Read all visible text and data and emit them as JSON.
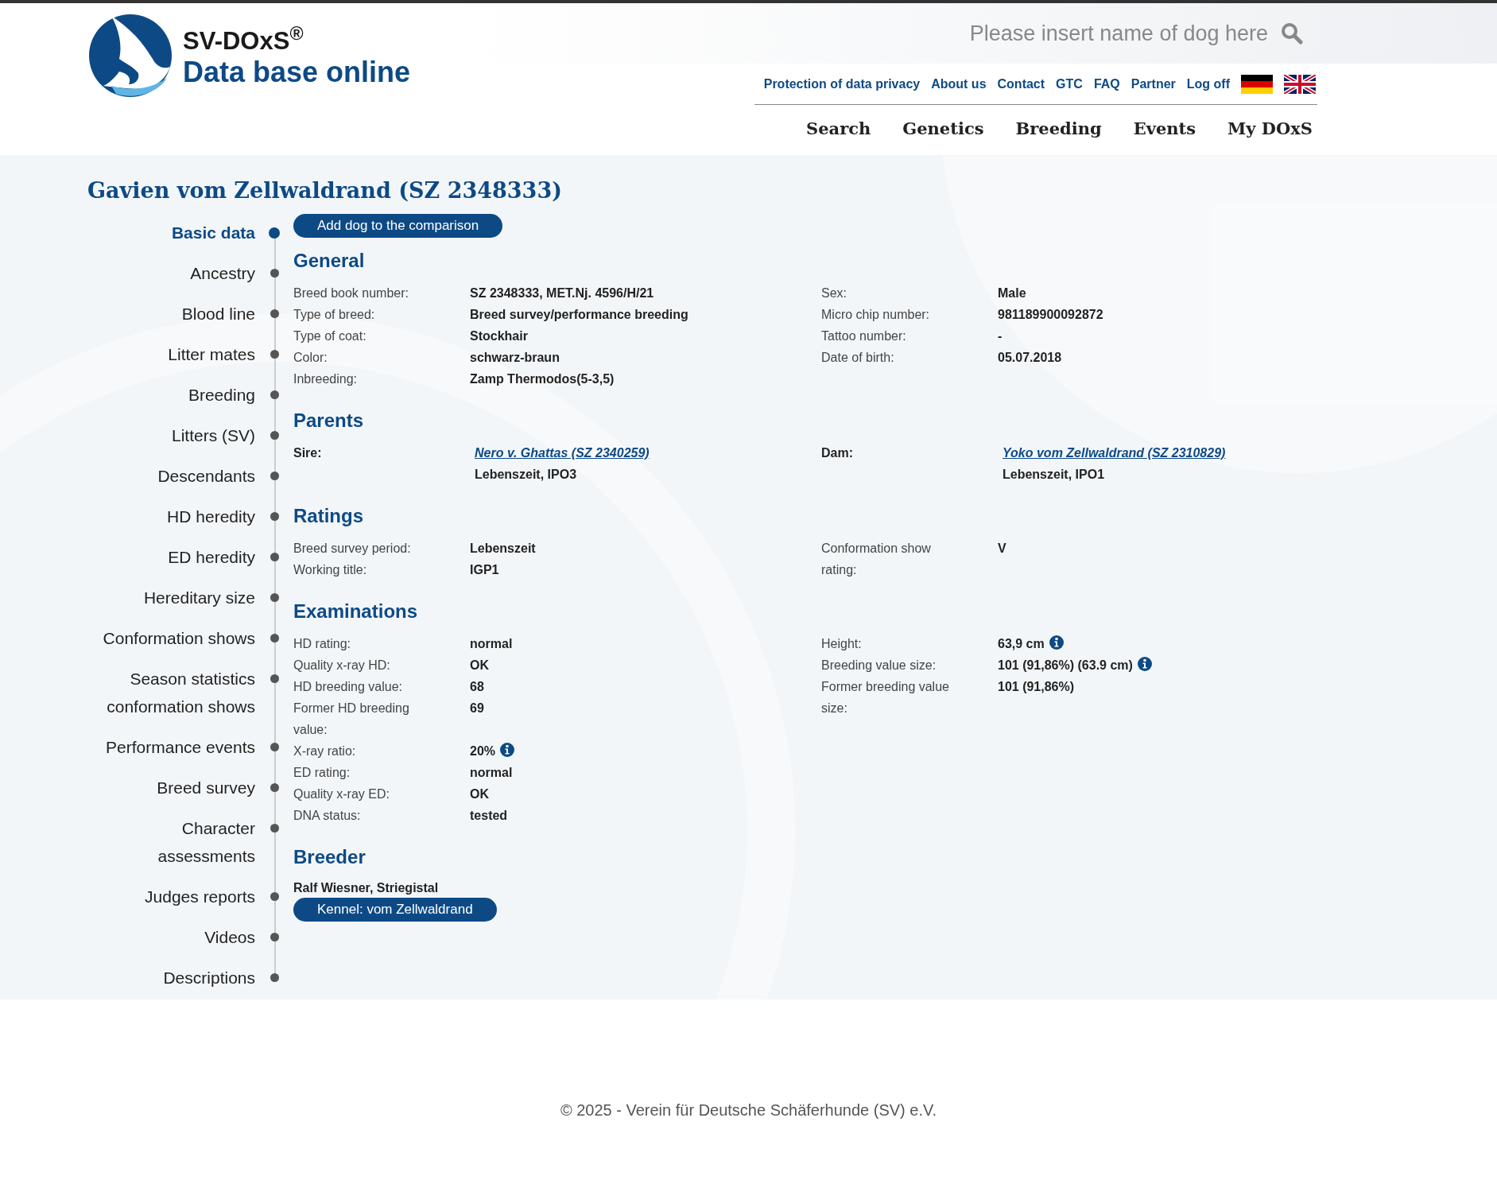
{
  "header": {
    "logo": {
      "name": "SV-DOxS$^{®}$",
      "tagline": "Data base online"
    },
    "search": {
      "placeholder": "Please insert name of dog here"
    },
    "top_links": [
      "Protection of data privacy",
      "About us",
      "Contact",
      "GTC",
      "FAQ",
      "Partner",
      "Log off"
    ],
    "languages": [
      {
        "kind": "german"
      },
      {
        "kind": "british"
      }
    ],
    "main_nav": [
      "Search",
      "Genetics",
      "Breeding",
      "Events",
      "My DOxS"
    ]
  },
  "title": "Gavien vom Zellwaldrand (SZ 2348333)",
  "side_nav": [
    {
      "label": "Basic data",
      "selected": true
    },
    {
      "label": "Ancestry",
      "selected": false
    },
    {
      "label": "Blood line",
      "selected": false
    },
    {
      "label": "Litter mates",
      "selected": false
    },
    {
      "label": "Breeding",
      "selected": false
    },
    {
      "label": "Litters (SV)",
      "selected": false
    },
    {
      "label": "Descendants",
      "selected": false
    },
    {
      "label": "HD heredity",
      "selected": false
    },
    {
      "label": "ED heredity",
      "selected": false
    },
    {
      "label": "Hereditary size",
      "selected": false
    },
    {
      "label": "Conformation shows",
      "selected": false
    },
    {
      "label": "Season statistics conformation shows",
      "selected": false
    },
    {
      "label": "Performance events",
      "selected": false
    },
    {
      "label": "Breed survey",
      "selected": false
    },
    {
      "label": "Character assessments",
      "selected": false
    },
    {
      "label": "Judges reports",
      "selected": false
    },
    {
      "label": "Videos",
      "selected": false
    },
    {
      "label": "Descriptions",
      "selected": false
    }
  ],
  "compare_button": "Add dog to the comparison",
  "sections": [
    {
      "heading": "General",
      "kind": "fields",
      "left": [
        {
          "label": "Breed book number:",
          "value": "SZ 2348333, MET.Nj. 4596/H/21"
        },
        {
          "label": "Type of breed:",
          "value": "Breed survey/performance breeding"
        },
        {
          "label": "Type of coat:",
          "value": "Stockhair"
        },
        {
          "label": "Color:",
          "value": "schwarz-braun"
        },
        {
          "label": "Inbreeding:",
          "value": "Zamp Thermodos(5-3,5)"
        }
      ],
      "right": [
        {
          "label": "Sex:",
          "value": "Male"
        },
        {
          "label": "Micro chip number:",
          "value": "981189900092872"
        },
        {
          "label": "Tattoo number:",
          "value": "-"
        },
        {
          "label": "Date of birth:",
          "value": "05.07.2018"
        }
      ]
    },
    {
      "heading": "Parents",
      "kind": "parents",
      "left": [
        {
          "label": "Sire:",
          "link": "Nero v. Ghattas (SZ 2340259)",
          "note": "Lebenszeit, IPO3"
        }
      ],
      "right": [
        {
          "label": "Dam:",
          "link": "Yoko vom Zellwaldrand (SZ 2310829)",
          "note": "Lebenszeit, IPO1"
        }
      ]
    },
    {
      "heading": "Ratings",
      "kind": "fields",
      "left": [
        {
          "label": "Breed survey period:",
          "value": "Lebenszeit"
        },
        {
          "label": "Working title:",
          "value": "IGP1"
        }
      ],
      "right": [
        {
          "label": "Conformation show rating:",
          "value": "V"
        }
      ]
    },
    {
      "heading": "Examinations",
      "kind": "fields",
      "left": [
        {
          "label": "HD rating:",
          "value": "normal"
        },
        {
          "label": "Quality x-ray HD:",
          "value": "OK"
        },
        {
          "label": "HD breeding value:",
          "value": "68"
        },
        {
          "label": "Former HD breeding value:",
          "value": "69"
        },
        {
          "label": "X-ray ratio:",
          "value": "20%",
          "info": true
        },
        {
          "label": "ED rating:",
          "value": "normal"
        },
        {
          "label": "Quality x-ray ED:",
          "value": "OK"
        },
        {
          "label": "DNA status:",
          "value": "tested"
        }
      ],
      "right": [
        {
          "label": "Height:",
          "value": "63,9 cm",
          "info": true
        },
        {
          "label": "Breeding value size:",
          "value": "101 (91,86%) (63.9 cm)",
          "info": true
        },
        {
          "label": "Former breeding value size:",
          "value": "101 (91,86%)"
        }
      ]
    },
    {
      "heading": "Breeder",
      "kind": "breeder",
      "name": "Ralf Wiesner, Striegistal",
      "kennel_button": "Kennel: vom Zellwaldrand"
    }
  ],
  "footer": "© 2025 - Verein für Deutsche Schäferhunde (SV) e.V."
}
